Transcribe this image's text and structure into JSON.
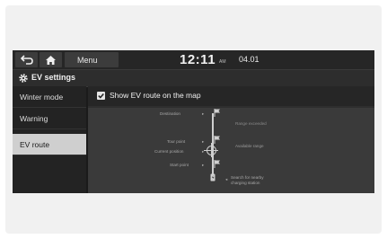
{
  "topbar": {
    "menu_label": "Menu",
    "time": "12:11",
    "ampm": "AM",
    "date": "04.01"
  },
  "header": {
    "title": "EV settings"
  },
  "sidebar": {
    "items": [
      {
        "label": "Winter mode",
        "active": false
      },
      {
        "label": "Warning",
        "active": false
      },
      {
        "label": "EV route",
        "active": true
      }
    ]
  },
  "content": {
    "option_label": "Show EV route on the map",
    "option_checked": true
  },
  "diagram": {
    "destination": "Destination",
    "range_exceeded": "Range exceeded",
    "tour_point": "Tour point",
    "available_range": "Available range",
    "current_position": "Current position",
    "start_point": "Start point",
    "search_station_line1": "Search for nearby",
    "search_station_line2": "charging station"
  },
  "icons": {
    "back": "back-arrow-icon",
    "home": "home-icon",
    "gear": "gear-icon",
    "check": "checkmark-icon",
    "flag": "flag-icon",
    "station": "charging-station-icon"
  }
}
